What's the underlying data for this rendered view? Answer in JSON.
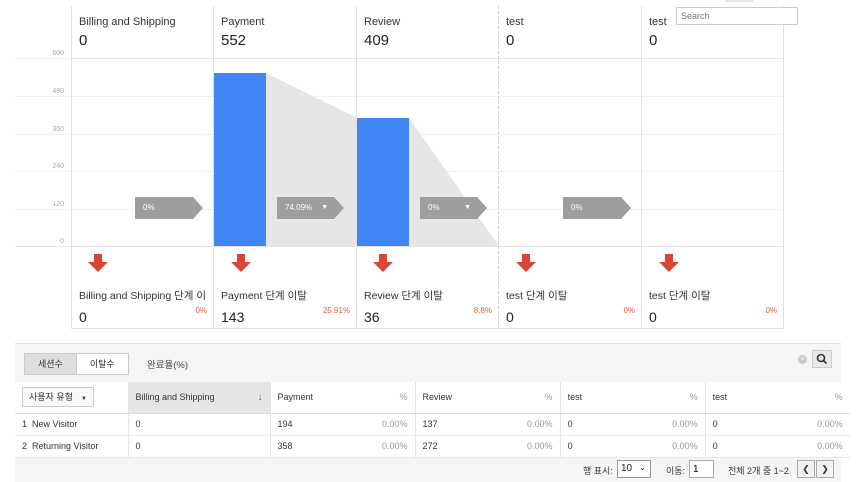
{
  "funnel": {
    "y_ticks": [
      "600",
      "480",
      "360",
      "240",
      "120",
      "0"
    ],
    "stages": [
      {
        "name": "Billing and Shipping",
        "value": "0",
        "sessions": 0
      },
      {
        "name": "Payment",
        "value": "552",
        "sessions": 552
      },
      {
        "name": "Review",
        "value": "409",
        "sessions": 409
      },
      {
        "name": "test",
        "value": "0",
        "sessions": 0
      },
      {
        "name": "test",
        "value": "0",
        "sessions": 0
      }
    ],
    "conversions": [
      "0%",
      "74.09%",
      "0%",
      "0%"
    ],
    "exits": [
      {
        "name": "Billing and Shipping 단계 이...",
        "value": "0",
        "pct": "0%"
      },
      {
        "name": "Payment 단계 이탈",
        "value": "143",
        "pct": "25.91%"
      },
      {
        "name": "Review 단계 이탈",
        "value": "36",
        "pct": "8.8%"
      },
      {
        "name": "test 단계 이탈",
        "value": "0",
        "pct": "0%"
      },
      {
        "name": "test 단계 이탈",
        "value": "0",
        "pct": "0%"
      }
    ],
    "bar_color": "#4285f4",
    "exit_arrow_color": "#db4437"
  },
  "tabs": {
    "sessions": "세션수",
    "exits": "이탈수",
    "completion": "완료율(%)"
  },
  "search": {
    "placeholder": "Search"
  },
  "table": {
    "dimension_label": "사용자 유형",
    "headers": [
      "Billing and Shipping",
      "Payment",
      "%",
      "Review",
      "%",
      "test",
      "%",
      "test",
      "%"
    ],
    "rows": [
      {
        "index": "1",
        "label": "New Visitor",
        "cells": [
          "0",
          "194",
          "0.00%",
          "137",
          "0.00%",
          "0",
          "0.00%",
          "0",
          "0.00%"
        ]
      },
      {
        "index": "2",
        "label": "Returning Visitor",
        "cells": [
          "0",
          "358",
          "0.00%",
          "272",
          "0.00%",
          "0",
          "0.00%",
          "0",
          "0.00%"
        ]
      }
    ]
  },
  "pager": {
    "rows_label": "행 표시:",
    "rows_value": "10",
    "goto_label": "이동:",
    "goto_value": "1",
    "range": "전체 2개 중 1~2"
  }
}
